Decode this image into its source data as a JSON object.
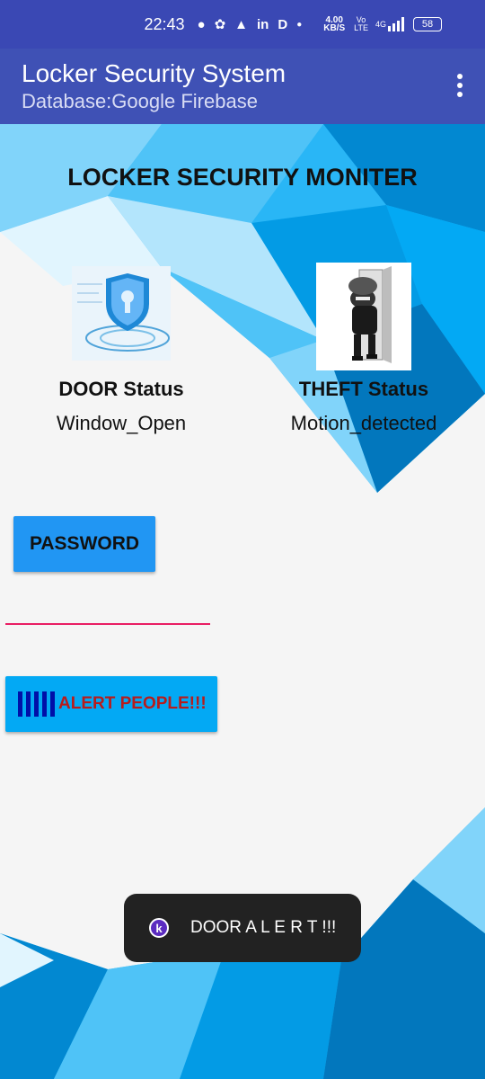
{
  "status_bar": {
    "time": "22:43",
    "netspeed_value": "4.00",
    "netspeed_unit": "KB/S",
    "volte_top": "Vo",
    "volte_bottom": "LTE",
    "network": "4G",
    "battery": "58"
  },
  "app_bar": {
    "title": "Locker Security System",
    "subtitle": "Database:Google Firebase"
  },
  "main": {
    "heading": "LOCKER SECURITY MONITER",
    "door": {
      "label": "DOOR Status",
      "value": "Window_Open"
    },
    "theft": {
      "label": "THEFT Status",
      "value": "Motion_detected"
    },
    "password_button": "PASSWORD",
    "alert_button": "ALERT PEOPLE!!!"
  },
  "toast": {
    "icon_letter": "k",
    "message": "DOOR A L E R T !!!"
  },
  "colors": {
    "status_bar": "#3a48b4",
    "app_bar": "#3f51b5",
    "password_button": "#2196f3",
    "alert_button": "#03a9f4",
    "alert_text": "#b71c1c",
    "underline": "#e91e63"
  }
}
